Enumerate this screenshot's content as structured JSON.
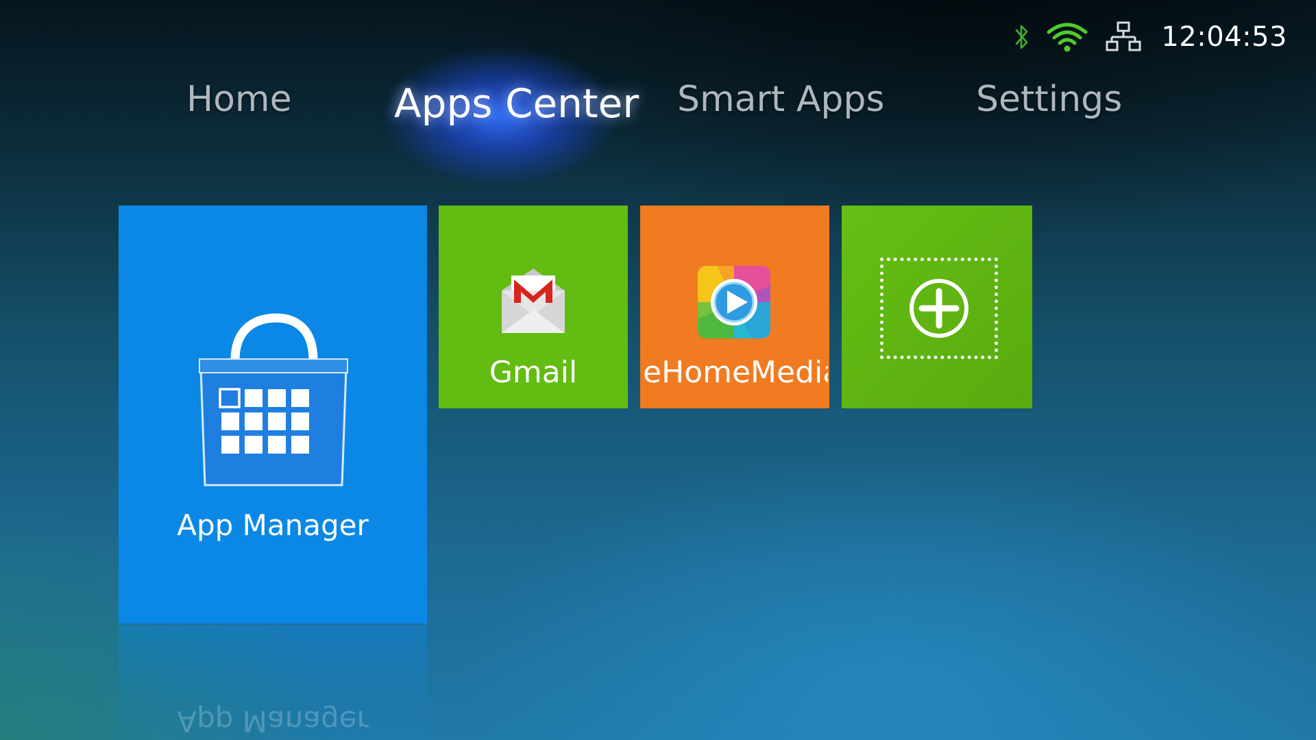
{
  "status_bar": {
    "icons": [
      "bluetooth-icon",
      "wifi-icon",
      "ethernet-icon"
    ],
    "time": "12:04:53",
    "colors": {
      "bluetooth": "#3fb22a",
      "wifi": "#4fcc2a",
      "ethernet": "#d8dde0"
    }
  },
  "nav": {
    "tabs": [
      {
        "label": "Home",
        "selected": false
      },
      {
        "label": "Apps Center",
        "selected": true
      },
      {
        "label": "Smart Apps",
        "selected": false
      },
      {
        "label": "Settings",
        "selected": false
      }
    ]
  },
  "tiles": [
    {
      "label": "App Manager",
      "icon": "shopping-bag-grid-icon",
      "color": "#0b88e6"
    },
    {
      "label": "Gmail",
      "icon": "gmail-envelope-icon",
      "color": "#62bc12"
    },
    {
      "label": "eHomeMedia",
      "icon": "media-play-icon",
      "color": "#f07b21"
    },
    {
      "label": "",
      "icon": "add-plus-icon",
      "color": "#62bc12"
    }
  ]
}
